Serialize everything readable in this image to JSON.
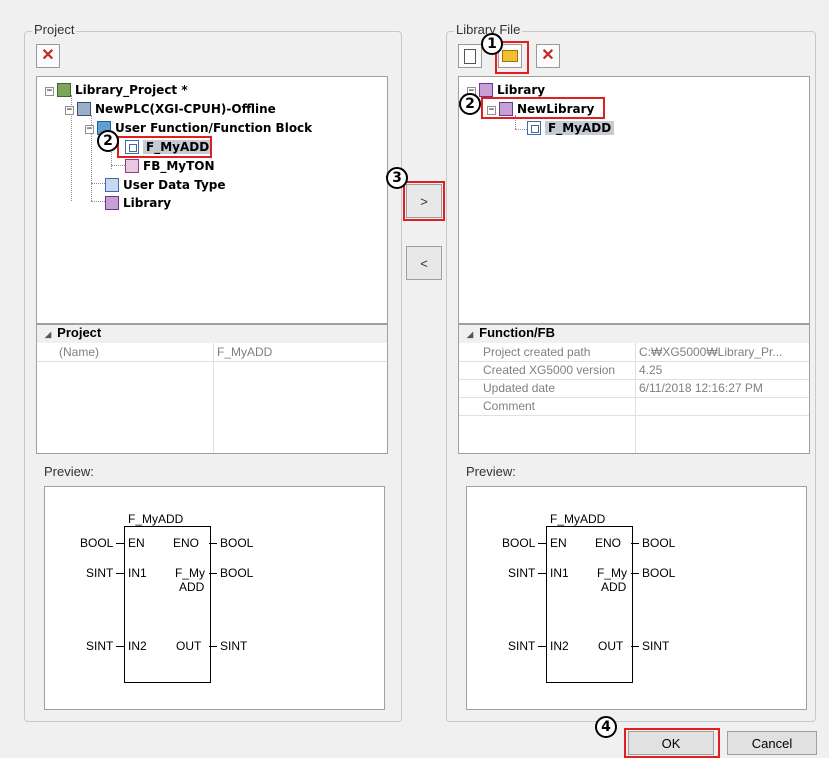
{
  "project_group": {
    "title": "Project",
    "tree": {
      "root": "Library_Project *",
      "plc": "NewPLC(XGI-CPUH)-Offline",
      "folder": "User Function/Function Block",
      "f_myadd": "F_MyADD",
      "fb_myton": "FB_MyTON",
      "user_data_type": "User Data Type",
      "library": "Library"
    },
    "properties": {
      "header": "Project",
      "rows": [
        {
          "key": "(Name)",
          "value": "F_MyADD"
        }
      ]
    },
    "preview_label": "Preview:"
  },
  "library_group": {
    "title": "Library File",
    "tree": {
      "root": "Library",
      "new_library": "NewLibrary",
      "f_myadd": "F_MyADD"
    },
    "properties": {
      "header": "Function/FB",
      "rows": [
        {
          "key": "Project created path",
          "value": "C:₩XG5000₩Library_Pr..."
        },
        {
          "key": "Created XG5000 version",
          "value": "4.25"
        },
        {
          "key": "Updated date",
          "value": "6/11/2018 12:16:27 PM"
        },
        {
          "key": "Comment",
          "value": ""
        }
      ]
    },
    "preview_label": "Preview:"
  },
  "transfer": {
    "right_label": ">",
    "left_label": "<"
  },
  "fb_block": {
    "name": "F_MyADD",
    "en_type": "BOOL",
    "en_pin": "EN",
    "eno_pin": "ENO",
    "eno_type": "BOOL",
    "in1_type": "SINT",
    "in1_pin": "IN1",
    "mid_label_1": "F_My",
    "mid_label_2": "ADD",
    "mid_type": "BOOL",
    "in2_type": "SINT",
    "in2_pin": "IN2",
    "out_pin": "OUT",
    "out_type": "SINT"
  },
  "callouts": {
    "c1": "1",
    "c2a": "2",
    "c2b": "2",
    "c3": "3",
    "c4": "4"
  },
  "footer": {
    "ok": "OK",
    "cancel": "Cancel"
  },
  "colors": {
    "highlight": "#e02020",
    "selection": "#c5cad3",
    "background": "#f0f0f0"
  }
}
